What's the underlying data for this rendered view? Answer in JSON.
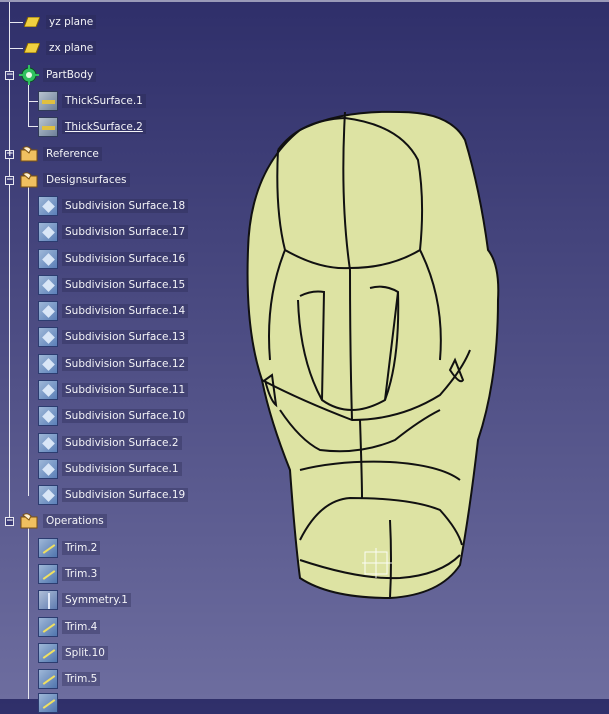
{
  "tree": {
    "items": [
      {
        "label": "yz plane",
        "icon": "plane-icon"
      },
      {
        "label": "zx plane",
        "icon": "plane-icon"
      },
      {
        "label": "PartBody",
        "icon": "gear-icon"
      },
      {
        "label": "ThickSurface.1",
        "icon": "thick-surface-icon"
      },
      {
        "label": "ThickSurface.2",
        "icon": "thick-surface-icon"
      },
      {
        "label": "Reference",
        "icon": "hand-folder-icon"
      },
      {
        "label": "Designsurfaces",
        "icon": "hand-folder-icon"
      },
      {
        "label": "Subdivision Surface.18",
        "icon": "subdivision-surface-icon"
      },
      {
        "label": "Subdivision Surface.17",
        "icon": "subdivision-surface-icon"
      },
      {
        "label": "Subdivision Surface.16",
        "icon": "subdivision-surface-icon"
      },
      {
        "label": "Subdivision Surface.15",
        "icon": "subdivision-surface-icon"
      },
      {
        "label": "Subdivision Surface.14",
        "icon": "subdivision-surface-icon"
      },
      {
        "label": "Subdivision Surface.13",
        "icon": "subdivision-surface-icon"
      },
      {
        "label": "Subdivision Surface.12",
        "icon": "subdivision-surface-icon"
      },
      {
        "label": "Subdivision Surface.11",
        "icon": "subdivision-surface-icon"
      },
      {
        "label": "Subdivision Surface.10",
        "icon": "subdivision-surface-icon"
      },
      {
        "label": "Subdivision Surface.2",
        "icon": "subdivision-surface-icon"
      },
      {
        "label": "Subdivision Surface.1",
        "icon": "subdivision-surface-icon"
      },
      {
        "label": "Subdivision Surface.19",
        "icon": "subdivision-surface-icon"
      },
      {
        "label": "Operations",
        "icon": "hand-folder-icon"
      },
      {
        "label": "Trim.2",
        "icon": "trim-icon"
      },
      {
        "label": "Trim.3",
        "icon": "trim-icon"
      },
      {
        "label": "Symmetry.1",
        "icon": "symmetry-icon"
      },
      {
        "label": "Trim.4",
        "icon": "trim-icon"
      },
      {
        "label": "Split.10",
        "icon": "split-icon"
      },
      {
        "label": "Trim.5",
        "icon": "trim-icon"
      }
    ],
    "expand_symbols": {
      "collapse": "−",
      "expand": "+"
    }
  },
  "viewport": {
    "model_fill": "#dde3a3",
    "model_stroke": "#111111",
    "background_top": "#2f2f6a",
    "background_bottom": "#6d6d9f"
  }
}
